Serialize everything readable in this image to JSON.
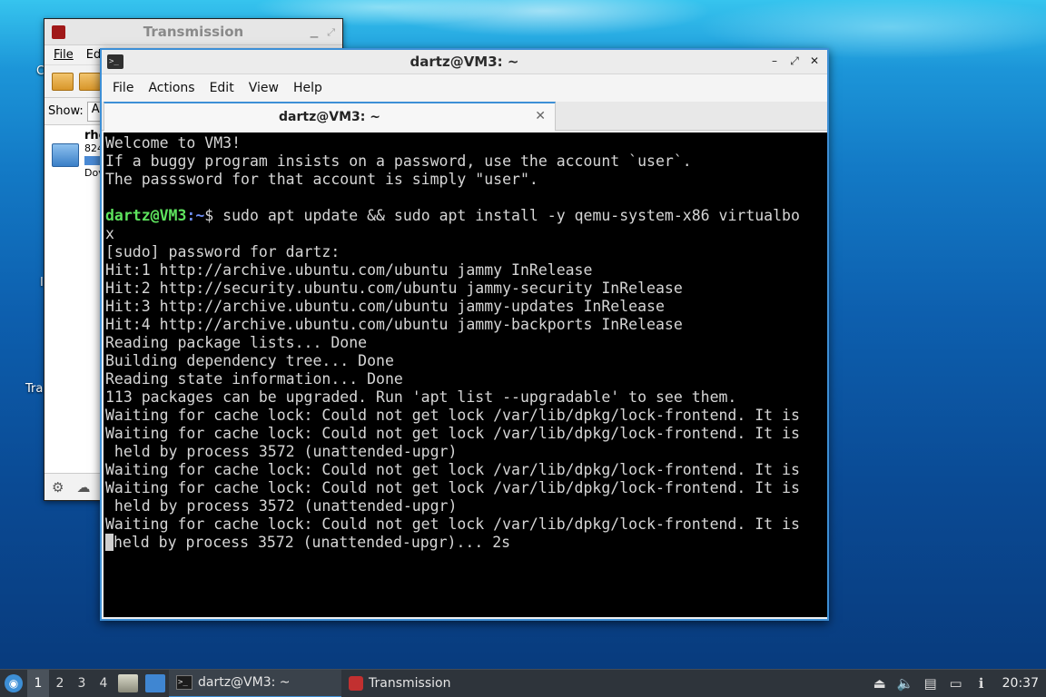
{
  "desktop": {
    "labels": [
      "C",
      "I",
      "Tra"
    ]
  },
  "transmission": {
    "title": "Transmission",
    "menu": [
      "File",
      "Ed"
    ],
    "show_label": "Show:",
    "filter_value": "A",
    "torrent": {
      "name": "rhe",
      "size": "824",
      "status": "Dov"
    }
  },
  "terminal": {
    "title": "dartz@VM3: ~",
    "menu": [
      "File",
      "Actions",
      "Edit",
      "View",
      "Help"
    ],
    "tab_label": "dartz@VM3: ~",
    "prompt_user": "dartz@VM3",
    "prompt_path": ":~",
    "prompt_symbol": "$ ",
    "command": "sudo apt update && sudo apt install -y qemu-system-x86 virtualbo",
    "lines_before": [
      "Welcome to VM3!",
      "If a buggy program insists on a password, use the account `user`.",
      "The passsword for that account is simply \"user\".",
      ""
    ],
    "lines_after": [
      "x",
      "[sudo] password for dartz:",
      "Hit:1 http://archive.ubuntu.com/ubuntu jammy InRelease",
      "Hit:2 http://security.ubuntu.com/ubuntu jammy-security InRelease",
      "Hit:3 http://archive.ubuntu.com/ubuntu jammy-updates InRelease",
      "Hit:4 http://archive.ubuntu.com/ubuntu jammy-backports InRelease",
      "Reading package lists... Done",
      "Building dependency tree... Done",
      "Reading state information... Done",
      "113 packages can be upgraded. Run 'apt list --upgradable' to see them.",
      "Waiting for cache lock: Could not get lock /var/lib/dpkg/lock-frontend. It is",
      "Waiting for cache lock: Could not get lock /var/lib/dpkg/lock-frontend. It is",
      " held by process 3572 (unattended-upgr)",
      "Waiting for cache lock: Could not get lock /var/lib/dpkg/lock-frontend. It is",
      "Waiting for cache lock: Could not get lock /var/lib/dpkg/lock-frontend. It is",
      " held by process 3572 (unattended-upgr)",
      "Waiting for cache lock: Could not get lock /var/lib/dpkg/lock-frontend. It is"
    ],
    "last_line": "held by process 3572 (unattended-upgr)... 2s"
  },
  "taskbar": {
    "workspaces": [
      "1",
      "2",
      "3",
      "4"
    ],
    "active_workspace": "1",
    "tasks": [
      {
        "label": "dartz@VM3: ~",
        "icon": "terminal-icon"
      },
      {
        "label": "Transmission",
        "icon": "transmission-icon"
      }
    ],
    "clock": "20:37"
  },
  "colors": {
    "accent": "#3d8fd6",
    "prompt_user": "#5ee35e",
    "prompt_path": "#6f8ff4",
    "terminal_bg": "#000000",
    "terminal_fg": "#d6d6d6"
  }
}
